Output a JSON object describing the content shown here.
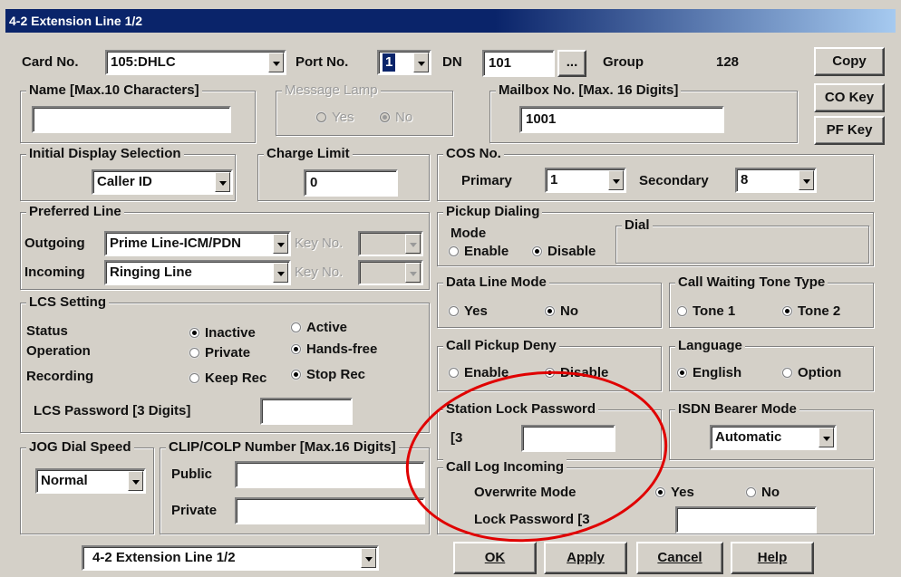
{
  "window": {
    "title": "4-2 Extension Line 1/2"
  },
  "header": {
    "card_no_label": "Card No.",
    "card_no_value": "105:DHLC",
    "port_no_label": "Port No.",
    "port_no_value": "1",
    "dn_label": "DN",
    "dn_value": "101",
    "dn_button": "...",
    "group_label": "Group",
    "group_value": "128"
  },
  "side_buttons": {
    "copy": "Copy",
    "co_key": "CO Key",
    "pf_key": "PF Key"
  },
  "name_group": {
    "title": "Name [Max.10 Characters]",
    "value": ""
  },
  "message_lamp": {
    "title": "Message Lamp",
    "yes": "Yes",
    "no": "No",
    "selected": "No"
  },
  "mailbox": {
    "title": "Mailbox No. [Max. 16 Digits]",
    "value": "1001"
  },
  "initial_display": {
    "title": "Initial Display Selection",
    "value": "Caller ID"
  },
  "charge_limit": {
    "title": "Charge Limit",
    "value": "0"
  },
  "cos": {
    "title": "COS No.",
    "primary_label": "Primary",
    "primary_value": "1",
    "secondary_label": "Secondary",
    "secondary_value": "8"
  },
  "preferred_line": {
    "title": "Preferred Line",
    "outgoing_label": "Outgoing",
    "outgoing_value": "Prime Line-ICM/PDN",
    "incoming_label": "Incoming",
    "incoming_value": "Ringing Line",
    "key_no_label": "Key No."
  },
  "pickup_dialing": {
    "title": "Pickup Dialing",
    "mode_label": "Mode",
    "dial_label": "Dial",
    "enable": "Enable",
    "disable": "Disable",
    "selected": "Disable"
  },
  "data_line_mode": {
    "title": "Data Line Mode",
    "yes": "Yes",
    "no": "No",
    "selected": "No"
  },
  "call_waiting": {
    "title": "Call Waiting Tone Type",
    "tone1": "Tone 1",
    "tone2": "Tone 2",
    "selected": "Tone 2"
  },
  "lcs": {
    "title": "LCS Setting",
    "status_label": "Status",
    "inactive": "Inactive",
    "active": "Active",
    "status_selected": "Inactive",
    "operation_label": "Operation",
    "private": "Private",
    "handsfree": "Hands-free",
    "operation_selected": "Hands-free",
    "recording_label": "Recording",
    "keep_rec": "Keep Rec",
    "stop_rec": "Stop Rec",
    "recording_selected": "Stop Rec",
    "password_label": "LCS Password [3 Digits]",
    "password_value": ""
  },
  "call_pickup_deny": {
    "title": "Call Pickup Deny",
    "enable": "Enable",
    "disable": "Disable",
    "selected": "Disable"
  },
  "language": {
    "title": "Language",
    "english": "English",
    "option": "Option",
    "selected": "English"
  },
  "station_lock": {
    "title": "Station Lock Password",
    "prefix": "[3",
    "value": ""
  },
  "isdn": {
    "title": "ISDN Bearer Mode",
    "value": "Automatic"
  },
  "jog": {
    "title": "JOG Dial Speed",
    "value": "Normal"
  },
  "clip": {
    "title": "CLIP/COLP Number [Max.16 Digits]",
    "public_label": "Public",
    "private_label": "Private",
    "public_value": "",
    "private_value": ""
  },
  "call_log": {
    "title": "Call Log Incoming",
    "overwrite_label": "Overwrite Mode",
    "yes": "Yes",
    "no": "No",
    "selected": "Yes",
    "lock_label": "Lock Password [3",
    "lock_value": ""
  },
  "footer": {
    "page_select": "4-2 Extension Line 1/2",
    "ok": "OK",
    "apply": "Apply",
    "cancel": "Cancel",
    "help": "Help"
  },
  "colors": {
    "title_bar": "#0a246a",
    "dialog_bg": "#d4d0c8",
    "annotation": "#e00000"
  }
}
